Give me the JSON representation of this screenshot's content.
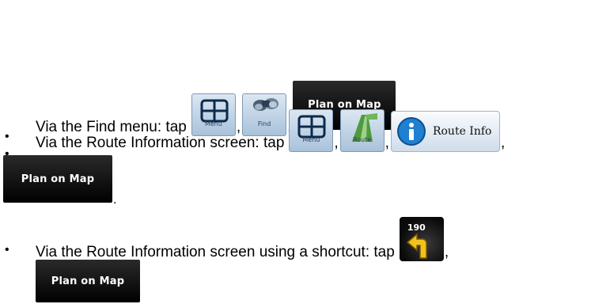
{
  "items": [
    {
      "bullet": "•",
      "lead": "Via the Find menu: tap",
      "menu_label": "Menu",
      "find_label": "Find",
      "plan_label": "Plan on Map",
      "sep1": ",",
      "sep2": ",",
      "end": "."
    },
    {
      "bullet": "•",
      "lead": "Via the Route Information screen: tap",
      "menu_label": "Menu",
      "route_label": "Route",
      "route_info_label": "Route Info",
      "plan_label": "Plan on Map",
      "sep1": ",",
      "sep2": ",",
      "sep3": ",",
      "end": "."
    },
    {
      "bullet": "•",
      "lead": "Via the Route Information screen using a shortcut: tap",
      "shortcut_distance": "190",
      "plan_label": "Plan on Map",
      "sep1": ","
    }
  ],
  "icons": {
    "menu": "menu-grid-icon",
    "find": "binoculars-icon",
    "route": "road-icon",
    "info": "info-icon",
    "turn": "turn-left-arrow-icon"
  },
  "colors": {
    "info_blue": "#1f7fd0",
    "arrow_yellow": "#f2c21b",
    "road_green": "#4e9a3e"
  }
}
